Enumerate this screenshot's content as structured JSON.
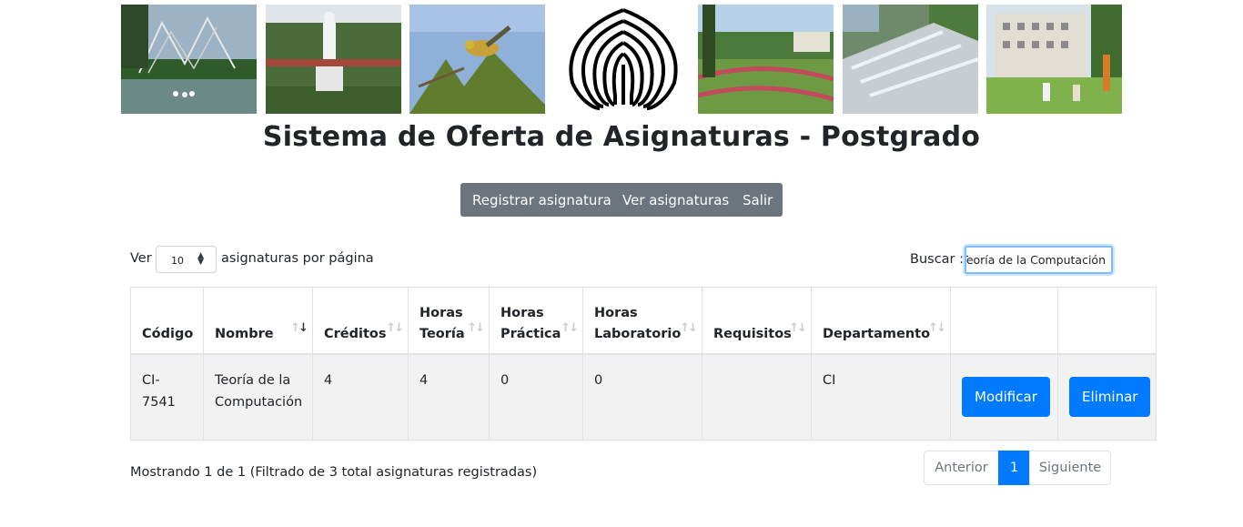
{
  "header": {
    "title": "Sistema de Oferta de Asignaturas - Postgrado"
  },
  "banner": {
    "photos": [
      "sculpture-lake-photo",
      "statue-photo",
      "bird-photo",
      "gardens-photo",
      "fountain-photo",
      "students-lawn-photo"
    ],
    "logo": "university-logo"
  },
  "nav": {
    "items": [
      "Registrar asignatura",
      "Ver asignaturas",
      "Salir"
    ]
  },
  "controls": {
    "length_prefix": "Ver",
    "length_value": "10",
    "length_suffix": "asignaturas por página",
    "search_label": "Buscar :",
    "search_value": "Teoría de la Computación"
  },
  "table": {
    "headers": [
      [
        "Código",
        ""
      ],
      [
        "Nombre",
        ""
      ],
      [
        "Créditos",
        ""
      ],
      [
        "Horas",
        "Teoría"
      ],
      [
        "Horas",
        "Práctica"
      ],
      [
        "Horas",
        "Laboratorio"
      ],
      [
        "Requisitos",
        ""
      ],
      [
        "Departamento",
        ""
      ]
    ],
    "rows": [
      {
        "codigo": "CI-7541",
        "nombre": "Teoría de la Computación",
        "creditos": "4",
        "horas_teoria": "4",
        "horas_practica": "0",
        "horas_laboratorio": "0",
        "requisitos": "",
        "departamento": "CI",
        "modify_label": "Modificar",
        "delete_label": "Eliminar"
      }
    ]
  },
  "footer": {
    "info": "Mostrando 1 de 1 (Filtrado de 3 total asignaturas registradas)",
    "prev_label": "Anterior",
    "current_page": "1",
    "next_label": "Siguiente"
  },
  "colors": {
    "primary": "#007bff",
    "nav_bg": "#6c757d",
    "row_bg": "#f2f2f2"
  }
}
